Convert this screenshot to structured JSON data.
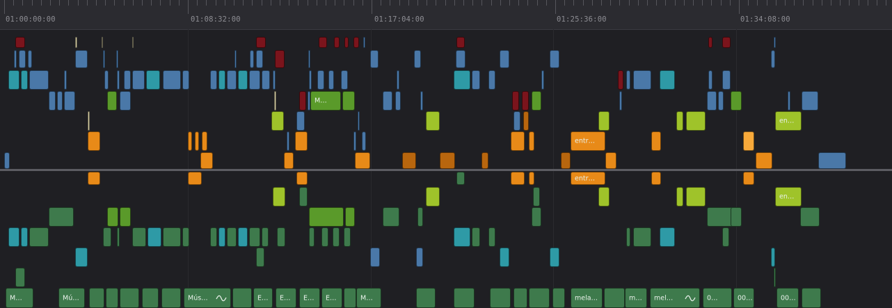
{
  "timecodes": [
    "01:00:00:00",
    "01:08:32:00",
    "01:17:04:00",
    "01:25:36:00",
    "01:34:08:00"
  ],
  "palette": {
    "dark_red": "#7b141c",
    "steel_blue": "#4a78a8",
    "teal": "#2e9aa6",
    "olive_green": "#5a9a2a",
    "lime": "#9fc32a",
    "orange": "#e88a18",
    "dark_orange": "#b8660e",
    "audio_green": "#3e7a4c",
    "background": "#1f1f23",
    "ruler": "#2b2b30"
  },
  "clip_labels": {
    "m_v1": "M…",
    "entr_v1": "entr…",
    "en_v1": "en…",
    "entr_a1": "entr…",
    "en_a1": "en…",
    "m_a": "M…",
    "mus_a": "Mú…",
    "mus2_a": "Mús…",
    "e1_a": "E…",
    "e2_a": "E…",
    "e3_a": "E…",
    "e4_a": "E…",
    "m2_a": "M…",
    "mela_a": "mela…",
    "m3_a": "m…",
    "mel_a": "mel…",
    "zero_a": "0…",
    "zz_a": "00…",
    "zz2_a": "00…"
  }
}
